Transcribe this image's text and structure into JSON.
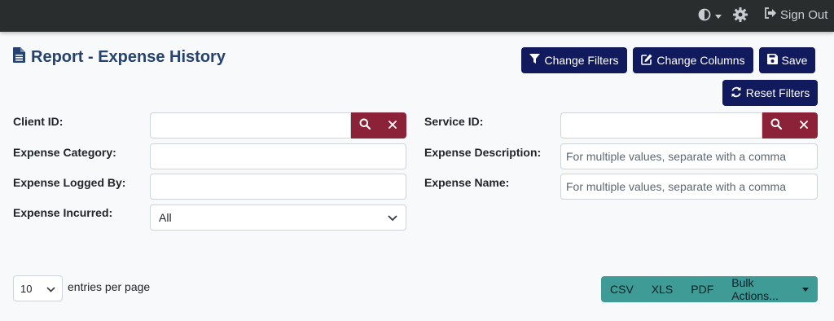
{
  "header": {
    "theme_icon": "contrast-icon",
    "settings_icon": "gear-icon",
    "sign_out_label": "Sign Out"
  },
  "page": {
    "title": "Report - Expense History",
    "title_icon": "file-icon"
  },
  "toolbar": {
    "change_filters_label": "Change Filters",
    "change_columns_label": "Change Columns",
    "save_label": "Save",
    "reset_filters_label": "Reset Filters"
  },
  "filters": {
    "client_id": {
      "label": "Client ID:",
      "value": ""
    },
    "service_id": {
      "label": "Service ID:",
      "value": ""
    },
    "expense_category": {
      "label": "Expense Category:",
      "value": ""
    },
    "expense_description": {
      "label": "Expense Description:",
      "placeholder": "For multiple values, separate with a comma"
    },
    "expense_logged_by": {
      "label": "Expense Logged By:",
      "value": ""
    },
    "expense_name": {
      "label": "Expense Name:",
      "placeholder": "For multiple values, separate with a comma"
    },
    "expense_incurred": {
      "label": "Expense Incurred:",
      "selected": "All"
    }
  },
  "table_controls": {
    "page_size": "10",
    "entries_label": "entries per page",
    "export": {
      "csv": "CSV",
      "xls": "XLS",
      "pdf": "PDF",
      "bulk_actions": "Bulk Actions..."
    }
  },
  "colors": {
    "topbar": "#2a2d2e",
    "navy_button": "#101a5c",
    "title": "#26426e",
    "addon": "#8c2237",
    "teal": "#3f9b96"
  }
}
